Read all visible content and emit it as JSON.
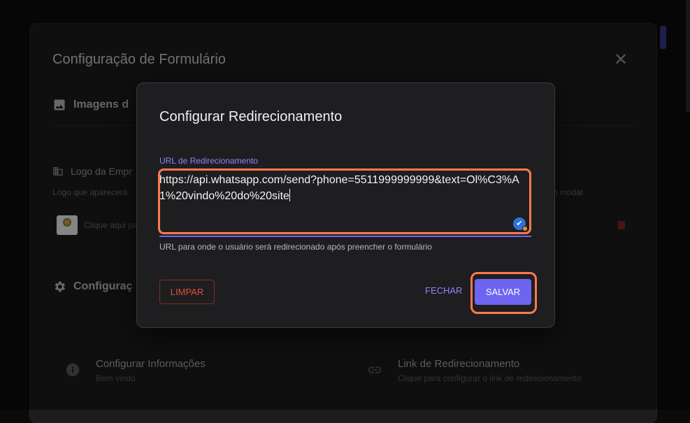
{
  "background": {
    "panel_title": "Configuração de Formulário",
    "images_section_title": "Imagens d",
    "logo_label": "Logo da Empr",
    "logo_desc_left": "Logo que aparecerá",
    "logo_desc_right": "o modal",
    "logo_click_text": "Clique aqui pa",
    "config_section_title": "Configuraç",
    "items": [
      {
        "title": "Configurar Informações",
        "subtitle": "Bem vindo"
      },
      {
        "title": "Link de Redirecionamento",
        "subtitle": "Clique para configurar o link de redirecionamento"
      }
    ]
  },
  "dialog": {
    "title": "Configurar Redirecionamento",
    "field_label": "URL de Redirecionamento",
    "field_value": "https://api.whatsapp.com/send?phone=5511999999999&text=Ol%C3%A1%20vindo%20do%20site",
    "helper_text": "URL para onde o usuário será redirecionado após preencher o formulário",
    "clear_label": "LIMPAR",
    "close_label": "FECHAR",
    "save_label": "SALVAR"
  },
  "colors": {
    "accent": "#6d64f0",
    "highlight": "#ff7a4d",
    "danger": "#d9513c"
  }
}
